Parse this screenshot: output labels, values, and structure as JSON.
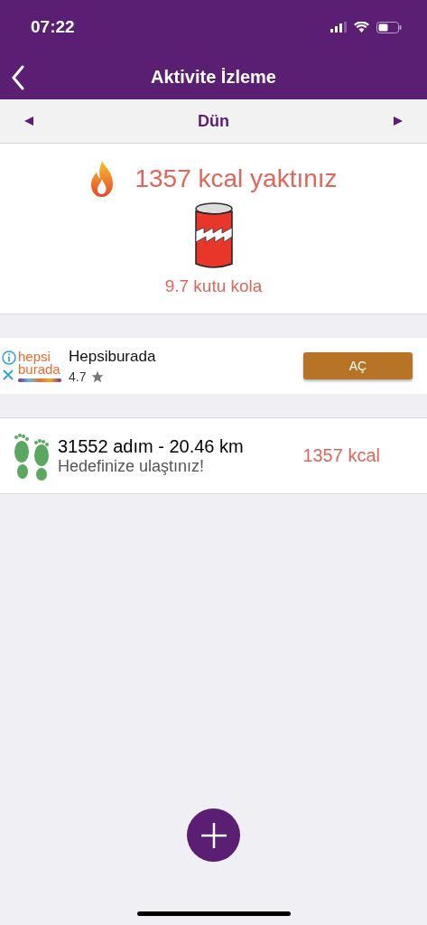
{
  "status_bar": {
    "time": "07:22"
  },
  "nav": {
    "title": "Aktivite İzleme"
  },
  "date_bar": {
    "label": "Dün"
  },
  "summary": {
    "burned": "1357 kcal yaktınız",
    "equivalent": "9.7 kutu kola"
  },
  "ad": {
    "logo_top": "hepsi",
    "logo_bottom": "burada",
    "name": "Hepsiburada",
    "rating": "4.7",
    "button": "AÇ"
  },
  "activities": [
    {
      "title": "31552 adım - 20.46 km",
      "subtitle": "Hedefinize ulaştınız!",
      "calories": "1357 kcal"
    }
  ]
}
